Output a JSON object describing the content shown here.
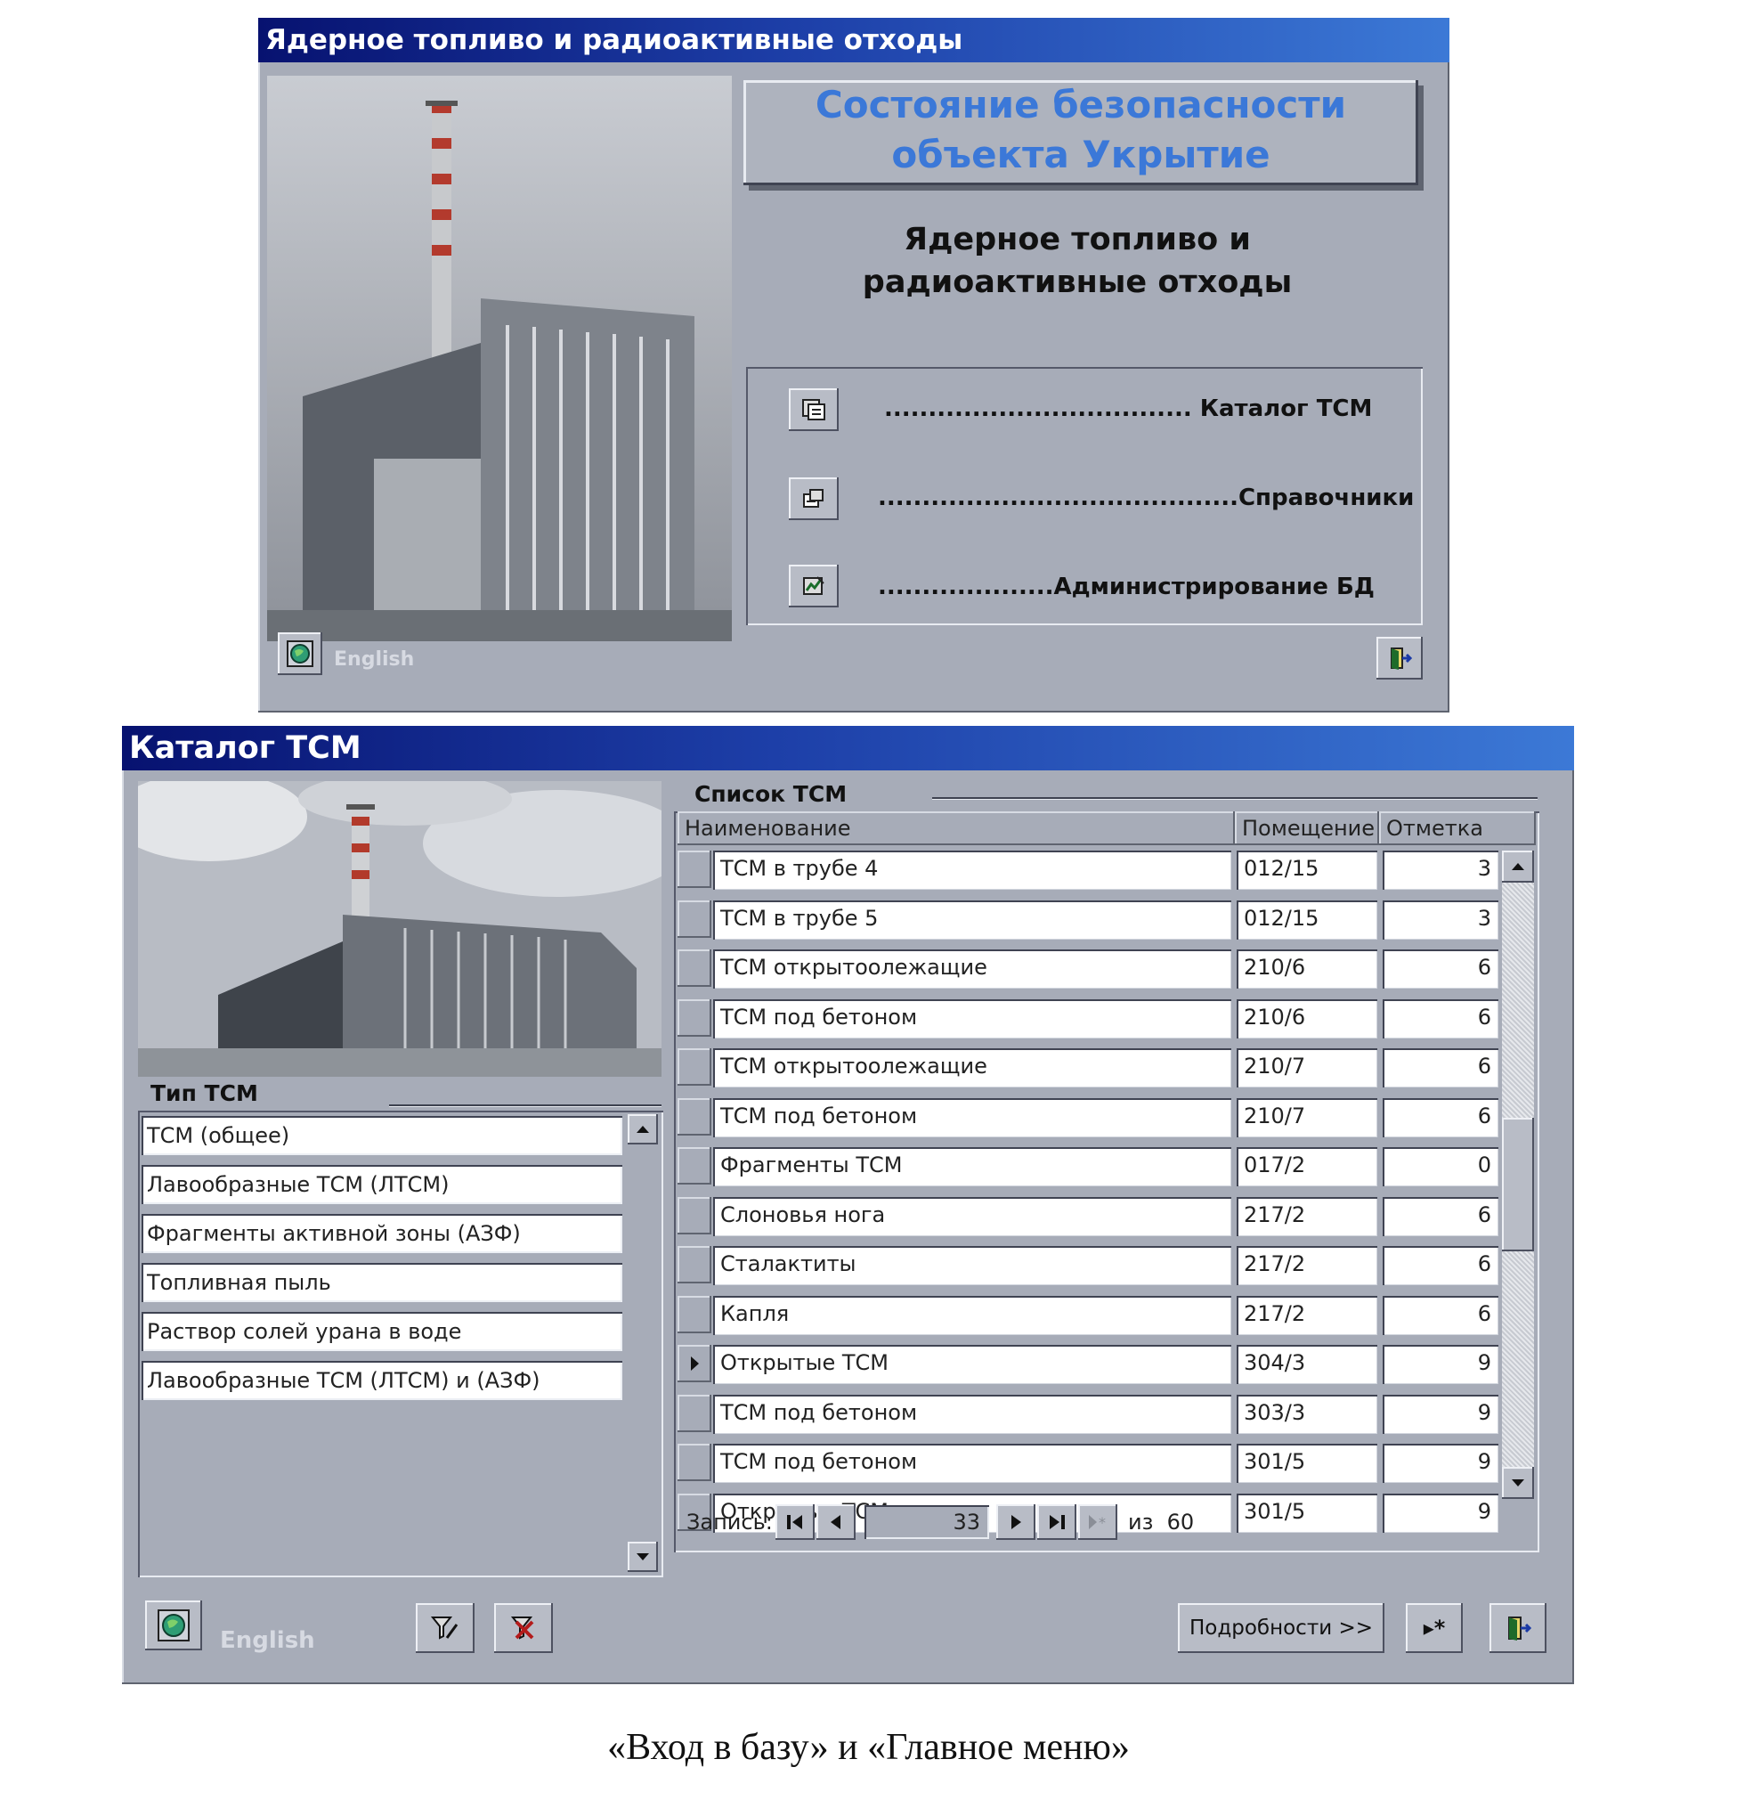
{
  "entry_window": {
    "title": "Ядерное топливо и радиоактивные отходы",
    "banner_line1": "Состояние безопасности",
    "banner_line2": "объекта Укрытие",
    "subtitle_line1": "Ядерное топливо и",
    "subtitle_line2": "радиоактивные отходы",
    "menu": [
      {
        "label": "................................... Каталог ТСМ",
        "icon": "catalog-icon"
      },
      {
        "label": ".........................................Справочники",
        "icon": "reference-icon"
      },
      {
        "label": "....................Администрирование БД",
        "icon": "admin-icon"
      }
    ],
    "language_label": "English"
  },
  "catalog_window": {
    "title": "Каталог ТСМ",
    "type_group_title": "Тип ТСМ",
    "types": [
      "ТСМ (общее)",
      "Лавообразные ТСМ (ЛТСМ)",
      "Фрагменты активной зоны (АЗФ)",
      "Топливная пыль",
      "Раствор солей урана в воде",
      "Лавообразные ТСМ (ЛТСМ) и (АЗФ)"
    ],
    "list_group_title": "Список ТСМ",
    "columns": [
      "Наименование",
      "Помещение",
      "Отметка"
    ],
    "rows": [
      {
        "name": "ТСМ в трубе 4",
        "room": "012/15",
        "mark": "3",
        "current": false
      },
      {
        "name": "ТСМ в трубе 5",
        "room": "012/15",
        "mark": "3",
        "current": false
      },
      {
        "name": "ТСМ открытоолежащие",
        "room": "210/6",
        "mark": "6",
        "current": false
      },
      {
        "name": "ТСМ под  бетоном",
        "room": "210/6",
        "mark": "6",
        "current": false
      },
      {
        "name": "ТСМ открытоолежащие",
        "room": "210/7",
        "mark": "6",
        "current": false
      },
      {
        "name": "ТСМ под бетоном",
        "room": "210/7",
        "mark": "6",
        "current": false
      },
      {
        "name": "Фрагменты ТСМ",
        "room": "017/2",
        "mark": "0",
        "current": false
      },
      {
        "name": "Слоновья нога",
        "room": "217/2",
        "mark": "6",
        "current": false
      },
      {
        "name": "Сталактиты",
        "room": "217/2",
        "mark": "6",
        "current": false
      },
      {
        "name": "Капля",
        "room": "217/2",
        "mark": "6",
        "current": false
      },
      {
        "name": "Открытые ТСМ",
        "room": "304/3",
        "mark": "9",
        "current": true
      },
      {
        "name": "ТСМ под бетоном",
        "room": "303/3",
        "mark": "9",
        "current": false
      },
      {
        "name": "ТСМ под  бетоном",
        "room": "301/5",
        "mark": "9",
        "current": false
      },
      {
        "name": "Открытые ТСМ",
        "room": "301/5",
        "mark": "9",
        "current": false
      }
    ],
    "record_label": "Запись:",
    "record_current": "33",
    "record_total_text": "из  60",
    "details_button": "Подробности >>",
    "new_record_button": "▸*",
    "language_label": "English"
  },
  "caption": "«Вход в базу» и «Главное меню»",
  "colors": {
    "window_bg": "#a7acb8",
    "title_gradient_start": "#071270",
    "title_gradient_end": "#3c79d6",
    "banner_text": "#3b78d8"
  }
}
